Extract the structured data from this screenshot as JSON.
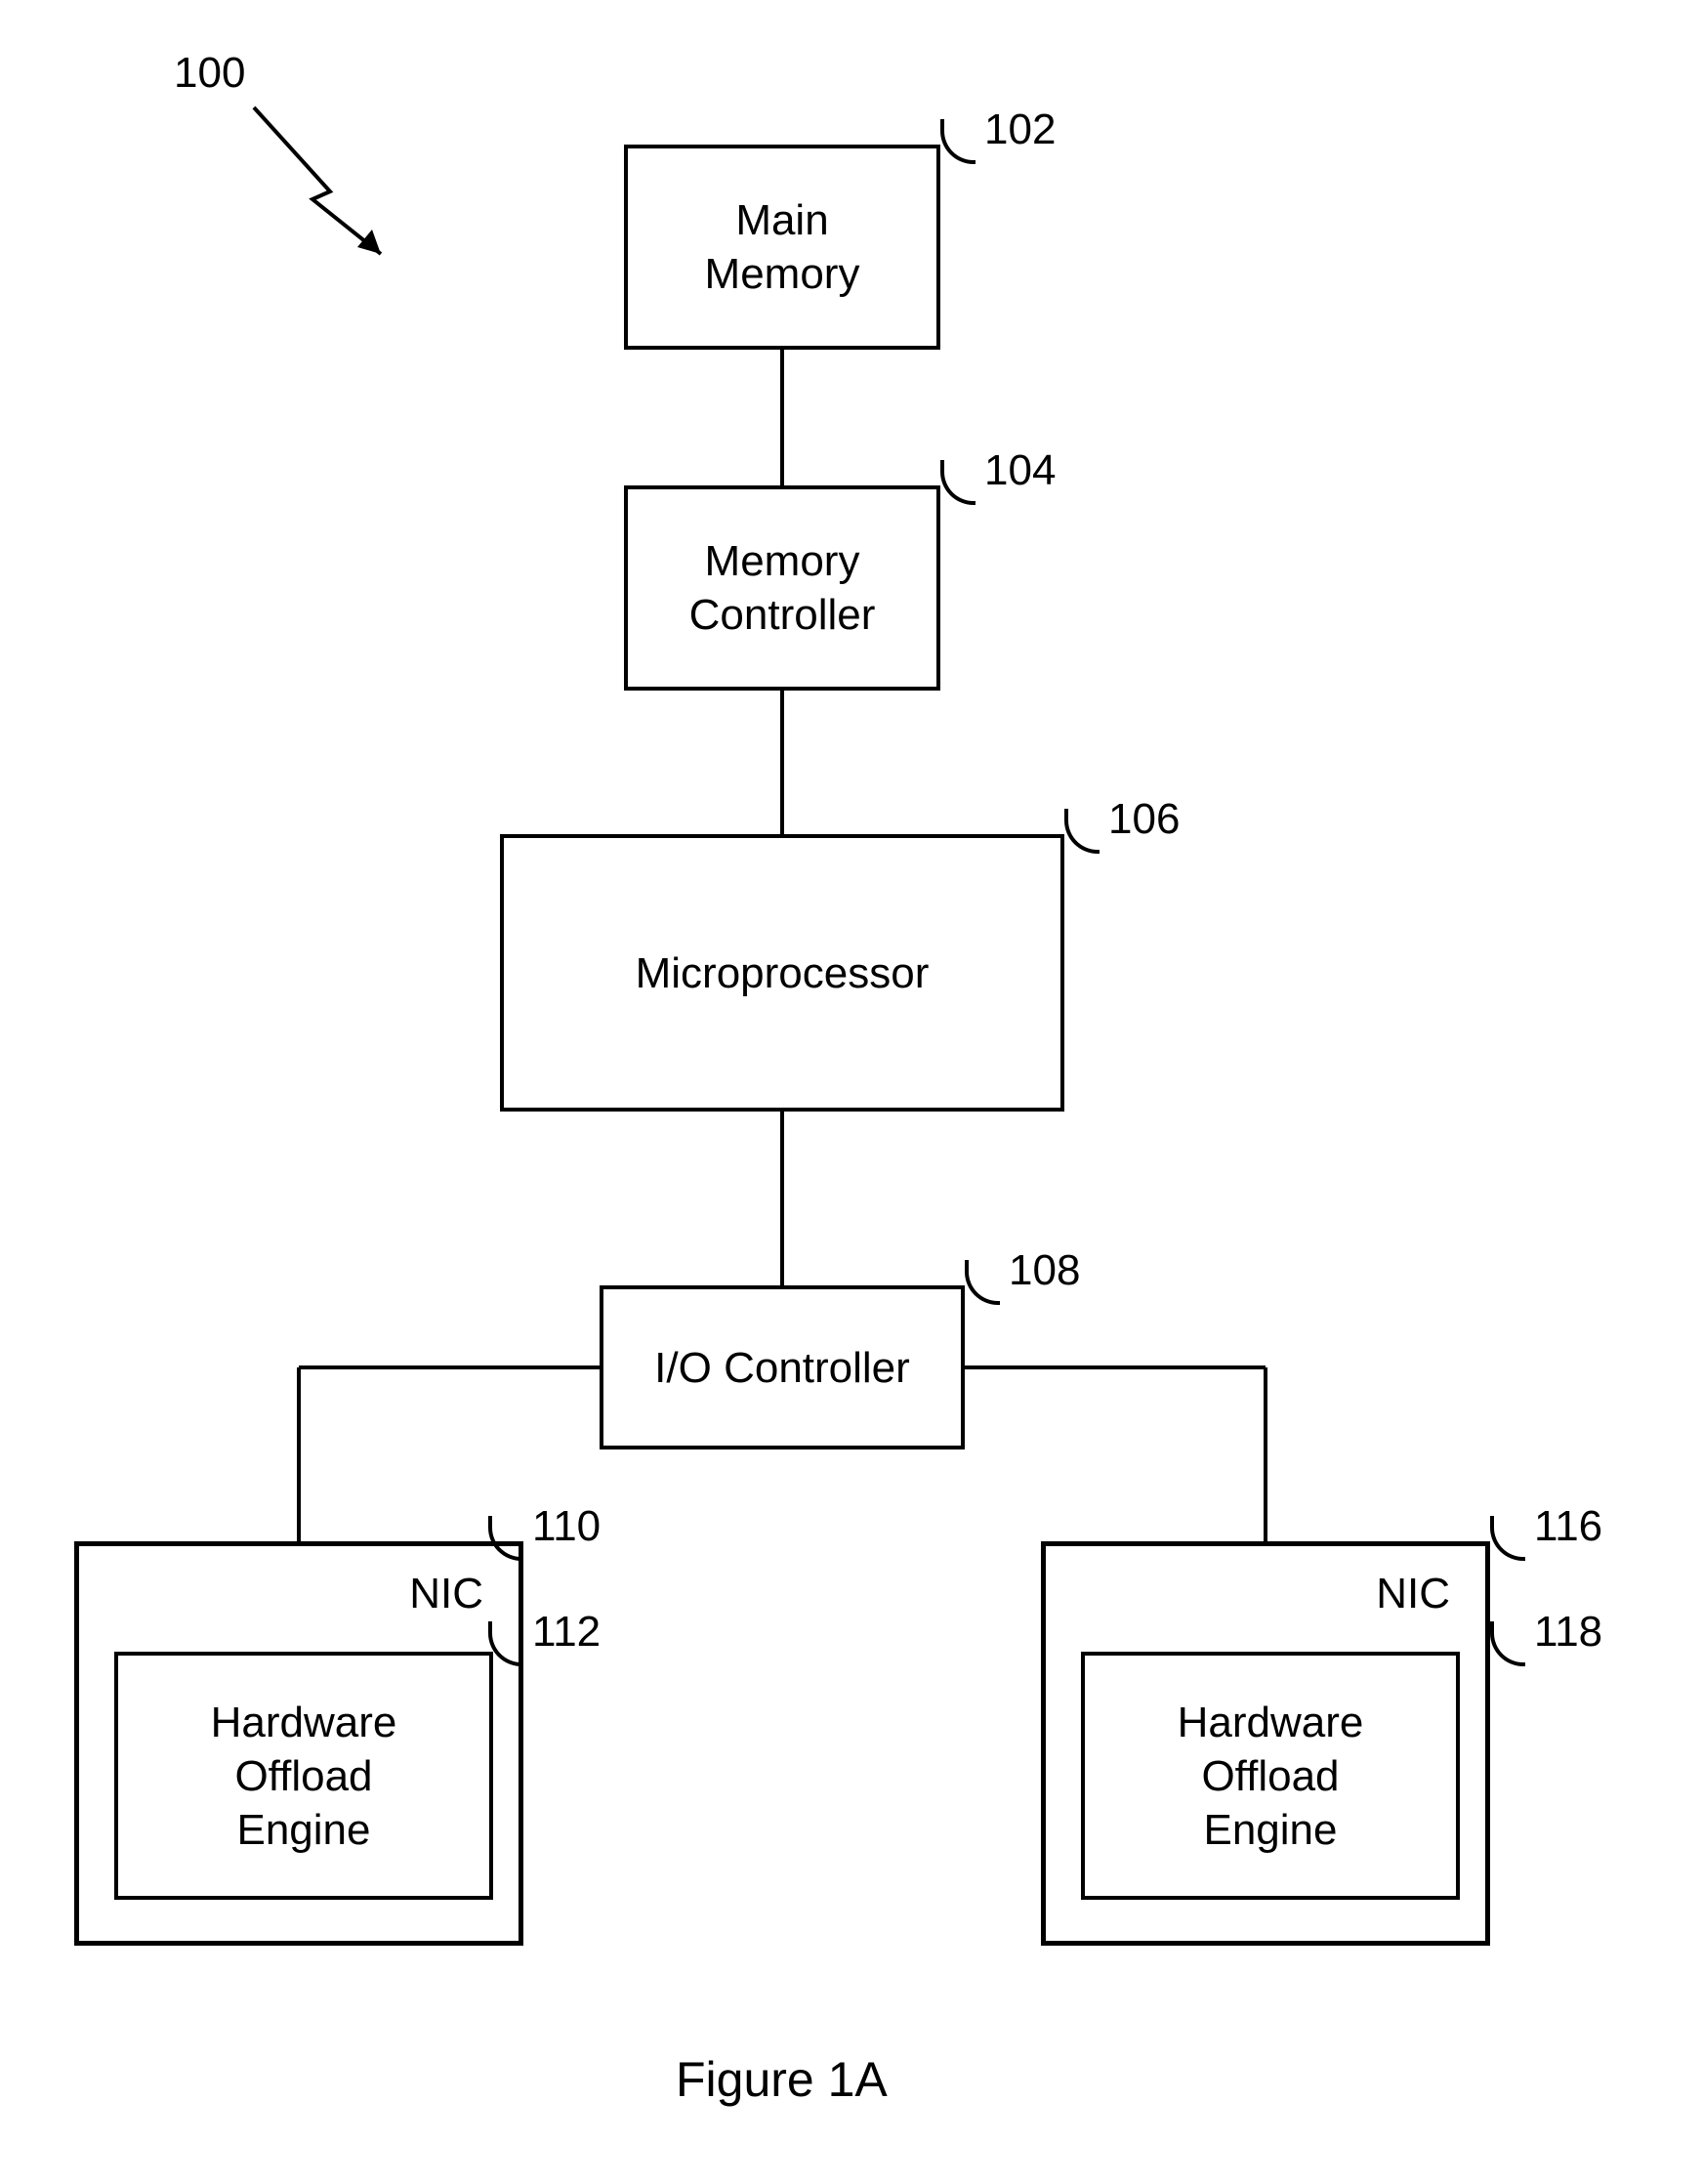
{
  "figure": {
    "refLabel": "100",
    "caption": "Figure 1A"
  },
  "blocks": {
    "mainMemory": {
      "label": "Main\nMemory",
      "ref": "102"
    },
    "memoryController": {
      "label": "Memory\nController",
      "ref": "104"
    },
    "microprocessor": {
      "label": "Microprocessor",
      "ref": "106"
    },
    "ioController": {
      "label": "I/O Controller",
      "ref": "108"
    },
    "nicLeft": {
      "title": "NIC",
      "ref": "110"
    },
    "hwLeft": {
      "label": "Hardware\nOffload\nEngine",
      "ref": "112"
    },
    "nicRight": {
      "title": "NIC",
      "ref": "116"
    },
    "hwRight": {
      "label": "Hardware\nOffload\nEngine",
      "ref": "118"
    }
  }
}
